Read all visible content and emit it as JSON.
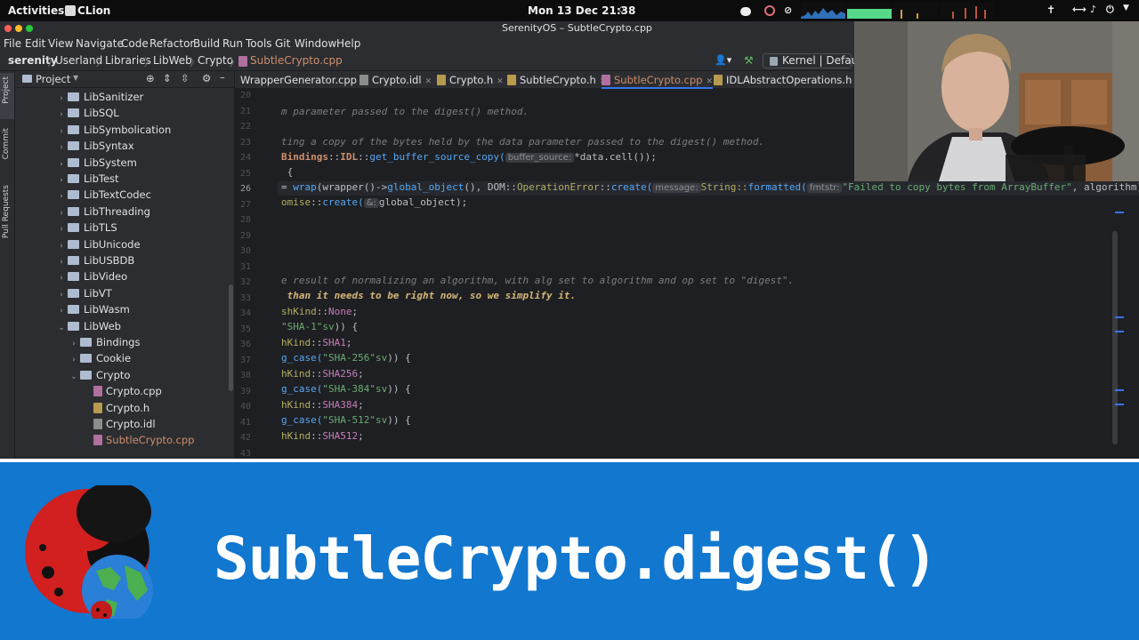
{
  "topbar": {
    "activities": "Activities",
    "app": "CLion",
    "clock": "Mon 13 Dec  21:38"
  },
  "window": {
    "title": "SerenityOS – SubtleCrypto.cpp"
  },
  "menu": [
    "File",
    "Edit",
    "View",
    "Navigate",
    "Code",
    "Refactor",
    "Build",
    "Run",
    "Tools",
    "Git",
    "Window",
    "Help"
  ],
  "breadcrumb": [
    "serenity",
    "Userland",
    "Libraries",
    "LibWeb",
    "Crypto",
    "SubtleCrypto.cpp"
  ],
  "run_config": "Kernel | Default",
  "side_tools": [
    "Project",
    "Commit",
    "Pull Requests"
  ],
  "project_panel": {
    "title": "Project",
    "items": [
      {
        "label": "LibSanitizer",
        "type": "folder",
        "depth": 1
      },
      {
        "label": "LibSQL",
        "type": "folder",
        "depth": 1
      },
      {
        "label": "LibSymbolication",
        "type": "folder",
        "depth": 1
      },
      {
        "label": "LibSyntax",
        "type": "folder",
        "depth": 1
      },
      {
        "label": "LibSystem",
        "type": "folder",
        "depth": 1
      },
      {
        "label": "LibTest",
        "type": "folder",
        "depth": 1
      },
      {
        "label": "LibTextCodec",
        "type": "folder",
        "depth": 1
      },
      {
        "label": "LibThreading",
        "type": "folder",
        "depth": 1
      },
      {
        "label": "LibTLS",
        "type": "folder",
        "depth": 1
      },
      {
        "label": "LibUnicode",
        "type": "folder",
        "depth": 1
      },
      {
        "label": "LibUSBDB",
        "type": "folder",
        "depth": 1
      },
      {
        "label": "LibVideo",
        "type": "folder",
        "depth": 1
      },
      {
        "label": "LibVT",
        "type": "folder",
        "depth": 1
      },
      {
        "label": "LibWasm",
        "type": "folder",
        "depth": 1
      },
      {
        "label": "LibWeb",
        "type": "folder-open",
        "depth": 1
      },
      {
        "label": "Bindings",
        "type": "folder",
        "depth": 2
      },
      {
        "label": "Cookie",
        "type": "folder",
        "depth": 2
      },
      {
        "label": "Crypto",
        "type": "folder-open",
        "depth": 2
      },
      {
        "label": "Crypto.cpp",
        "type": "file",
        "depth": 3
      },
      {
        "label": "Crypto.h",
        "type": "file",
        "depth": 3
      },
      {
        "label": "Crypto.idl",
        "type": "file",
        "depth": 3
      },
      {
        "label": "SubtleCrypto.cpp",
        "type": "file-active",
        "depth": 3
      }
    ]
  },
  "tabs": [
    {
      "label": "WrapperGenerator.cpp"
    },
    {
      "label": "Crypto.idl"
    },
    {
      "label": "Crypto.h"
    },
    {
      "label": "SubtleCrypto.h"
    },
    {
      "label": "SubtleCrypto.cpp",
      "active": true
    },
    {
      "label": "IDLAbstractOperations.h"
    }
  ],
  "code": {
    "line_numbers": [
      "20",
      "21",
      "22",
      "23",
      "24",
      "25",
      "26",
      "27",
      "28",
      "29",
      "30",
      "31",
      "32",
      "33",
      "34",
      "35",
      "36",
      "37",
      "38",
      "39",
      "40",
      "41",
      "42",
      "43"
    ],
    "l21": "m parameter passed to the digest() method.",
    "l23": "ting a copy of the bytes held by the data parameter passed to the digest() method.",
    "l24_a": "Bindings",
    "l24_b": "::",
    "l24_c": "IDL",
    "l24_d": "::",
    "l24_e": "get_buffer_source_copy(",
    "l24_hint": "buffer_source:",
    "l24_f": "*data.cell());",
    "l25": " {",
    "l26_a": "= ",
    "l26_b": "wrap",
    "l26_c": "(wrapper()->",
    "l26_d": "global_object",
    "l26_e": "(), DOM::",
    "l26_f": "OperationError",
    "l26_g": "::",
    "l26_h": "create(",
    "l26_hint1": "message:",
    "l26_i": "String::",
    "l26_j": "formatted(",
    "l26_hint2": "fmtstr:",
    "l26_k": "\"Failed to copy bytes from ArrayBuffer\"",
    "l26_l": ", algorithm)",
    "l27_a": "omise",
    "l27_b": "::",
    "l27_c": "create(",
    "l27_hint": "&:",
    "l27_d": "global_object);",
    "l32": "e result of normalizing an algorithm, with alg set to algorithm and op set to \"digest\".",
    "l33": " than it needs to be right now, so we simplify it.",
    "l34_a": "shKind",
    "l34_b": "::",
    "l34_c": "None",
    "l34_d": ";",
    "l35_a": "\"SHA-1\"sv",
    "l35_b": ")) {",
    "l36_a": "hKind",
    "l36_b": "::",
    "l36_c": "SHA1",
    "l36_d": ";",
    "l37_a": "g_case(",
    "l37_b": "\"SHA-256\"sv",
    "l37_c": ")) {",
    "l38_a": "hKind",
    "l38_b": "::",
    "l38_c": "SHA256",
    "l38_d": ";",
    "l39_a": "g_case(",
    "l39_b": "\"SHA-384\"sv",
    "l39_c": ")) {",
    "l40_a": "hKind",
    "l40_b": "::",
    "l40_c": "SHA384",
    "l40_d": ";",
    "l41_a": "g_case(",
    "l41_b": "\"SHA-512\"sv",
    "l41_c": ")) {",
    "l42_a": "hKind",
    "l42_b": "::",
    "l42_c": "SHA512",
    "l42_d": ";"
  },
  "banner": {
    "title": "SubtleCrypto.digest()",
    "background": "#1177cf"
  },
  "colors": {
    "accent": "#1177cf",
    "active_tab": "#cf8e6d"
  }
}
